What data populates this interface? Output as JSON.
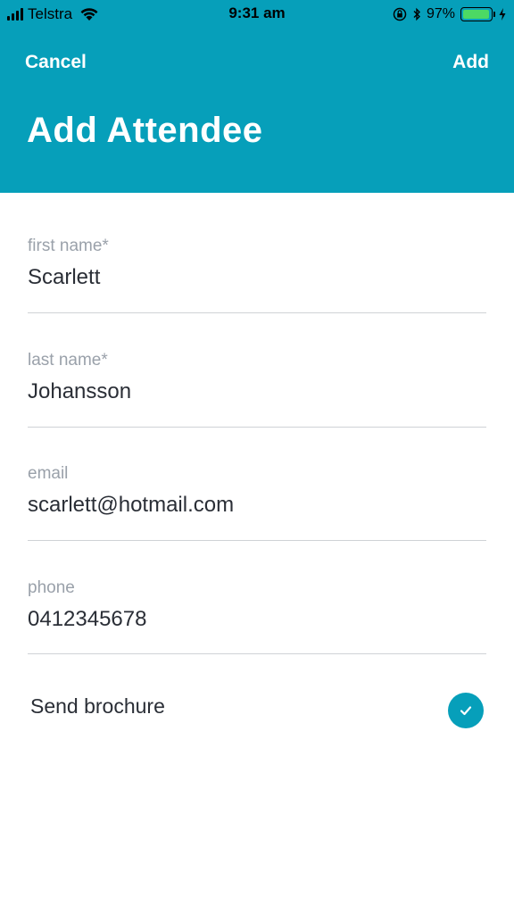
{
  "status_bar": {
    "carrier": "Telstra",
    "time": "9:31 am",
    "battery_percent": "97%",
    "battery_level": 0.97
  },
  "nav": {
    "cancel_label": "Cancel",
    "add_label": "Add",
    "title": "Add Attendee"
  },
  "form": {
    "fields": [
      {
        "label": "first name*",
        "value": "Scarlett"
      },
      {
        "label": "last name*",
        "value": "Johansson"
      },
      {
        "label": "email",
        "value": "scarlett@hotmail.com"
      },
      {
        "label": "phone",
        "value": "0412345678"
      }
    ],
    "send_brochure": {
      "label": "Send brochure",
      "checked": true
    }
  },
  "colors": {
    "accent": "#069fba",
    "label_gray": "#9aa1aa",
    "text_dark": "#2a2e36",
    "battery_green": "#4cd964"
  }
}
